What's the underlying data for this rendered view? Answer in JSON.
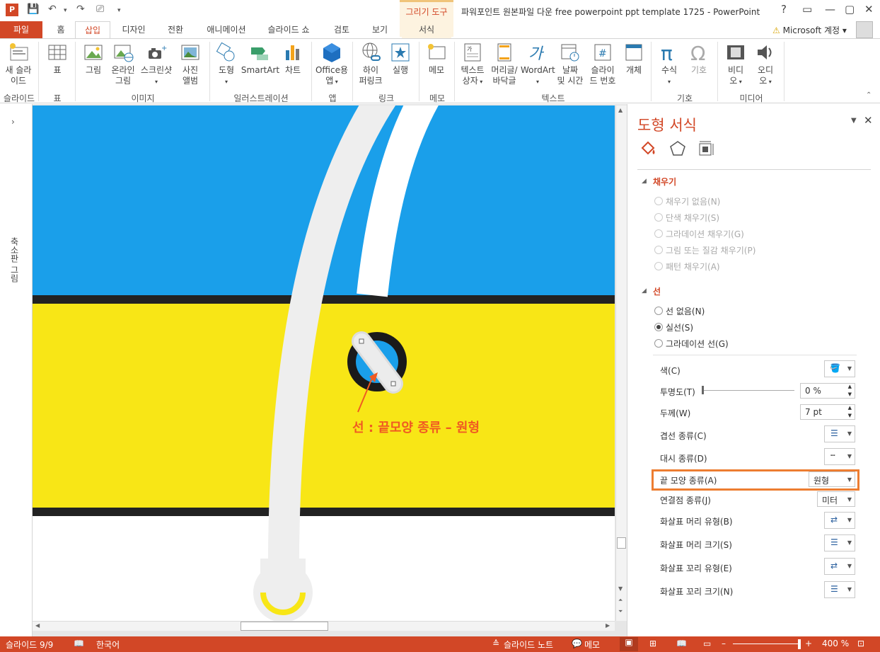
{
  "app": {
    "title": "파워포인트 원본파일 다운 free powerpoint ppt template 1725 - PowerPoint",
    "context_tab": "그리기 도구",
    "account": "Microsoft 계정",
    "accent": "#d24726"
  },
  "tabs": [
    "파일",
    "홈",
    "삽입",
    "디자인",
    "전환",
    "애니메이션",
    "슬라이드 쇼",
    "검토",
    "보기",
    "서식"
  ],
  "ribbon": {
    "buttons": [
      "새 슬라\n이드",
      "표",
      "그림",
      "온라인\n그림",
      "스크린샷",
      "사진\n앨범",
      "도형",
      "SmartArt",
      "차트",
      "Office용\n앱",
      "하이\n퍼링크",
      "실행",
      "메모",
      "텍스트\n상자",
      "머리글/\n바닥글",
      "WordArt",
      "날짜\n및 시간",
      "슬라이\n드 번호",
      "개체",
      "수식",
      "기호",
      "비디\n오",
      "오디\n오"
    ],
    "groups": [
      "슬라이드",
      "표",
      "이미지",
      "일러스트레이션",
      "앱",
      "링크",
      "메모",
      "텍스트",
      "기호",
      "미디어"
    ]
  },
  "left_pane": {
    "label": "축소판 그림"
  },
  "slide": {
    "annotation": "선 : 끝모양 종류 – 원형",
    "colors": {
      "blue": "#1a9fea",
      "yellow": "#f8e616",
      "dark": "#222222",
      "gray": "#eeeeee",
      "orange": "#f05a22"
    }
  },
  "format_pane": {
    "title": "도형 서식",
    "icons": [
      "fill-line-icon",
      "effects-icon",
      "size-properties-icon"
    ],
    "fill_section": "채우기",
    "fill_options": [
      "채우기 없음(N)",
      "단색 채우기(S)",
      "그라데이션 채우기(G)",
      "그림 또는 질감 채우기(P)",
      "패턴 채우기(A)"
    ],
    "line_section": "선",
    "line_options": [
      "선 없음(N)",
      "실선(S)",
      "그라데이션 선(G)"
    ],
    "props": {
      "color": "색(C)",
      "transparency": "투명도(T)",
      "transparency_value": "0 %",
      "width": "두께(W)",
      "width_value": "7 pt",
      "compound": "겹선 종류(C)",
      "dash": "대시 종류(D)",
      "cap": "끝 모양 종류(A)",
      "cap_value": "원형",
      "join": "연결점 종류(J)",
      "join_value": "미터",
      "begin_arrow_type": "화살표 머리 유형(B)",
      "begin_arrow_size": "화살표 머리 크기(S)",
      "end_arrow_type": "화살표 꼬리 유형(E)",
      "end_arrow_size": "화살표 꼬리 크기(N)"
    }
  },
  "status": {
    "slide": "슬라이드 9/9",
    "language": "한국어",
    "notes": "슬라이드 노트",
    "comments": "메모",
    "zoom": "400 %"
  }
}
